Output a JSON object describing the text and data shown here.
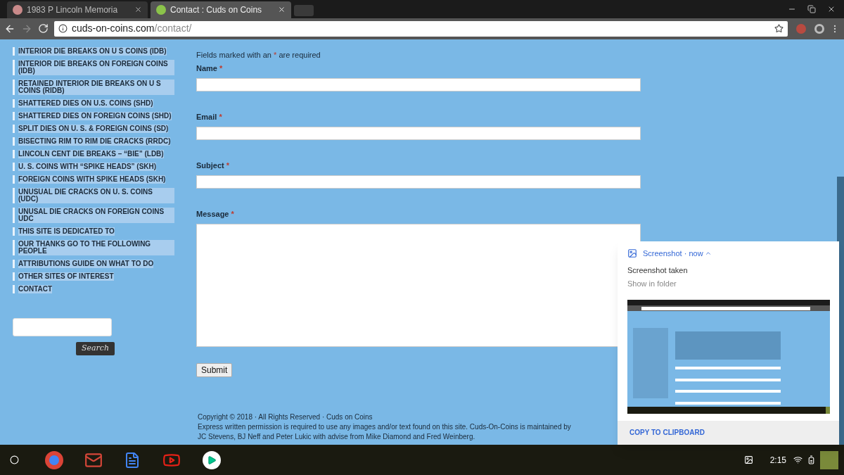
{
  "browser": {
    "tabs": [
      {
        "title": "1983 P Lincoln Memoria",
        "selected": false
      },
      {
        "title": "Contact : Cuds on Coins",
        "selected": true
      }
    ],
    "url_host": "cuds-on-coins.com",
    "url_path": "/contact/"
  },
  "sidebar": {
    "items": [
      {
        "label": "INTERIOR DIE BREAKS ON U S COINS (IDB)"
      },
      {
        "label": "INTERIOR DIE BREAKS ON FOREIGN COINS (IDB)"
      },
      {
        "label": "RETAINED INTERIOR DIE BREAKS ON U S COINS (RIDB)"
      },
      {
        "label": "SHATTERED DIES ON U.S. COINS (SHD)"
      },
      {
        "label": "SHATTERED DIES ON FOREIGN COINS (SHD)"
      },
      {
        "label": "SPLIT DIES ON U. S. & FOREIGN COINS (SD)"
      },
      {
        "label": "BISECTING RIM TO RIM DIE CRACKS (RRDC)"
      },
      {
        "label": "LINCOLN CENT DIE BREAKS – “BIE” (LDB)"
      },
      {
        "label": "U. S. COINS WITH “SPIKE HEADS” (SKH)"
      },
      {
        "label": "FOREIGN COINS WITH SPIKE HEADS (SKH)"
      },
      {
        "label": "UNUSUAL DIE CRACKS ON U. S. COINS (UDC)"
      },
      {
        "label": "UNUSAL DIE CRACKS ON FOREIGN COINS UDC"
      },
      {
        "label": "THIS SITE IS DEDICATED TO"
      },
      {
        "label": "OUR THANKS GO TO THE FOLLOWING PEOPLE"
      },
      {
        "label": "ATTRIBUTIONS GUIDE ON WHAT TO DO"
      },
      {
        "label": "OTHER SITES OF INTEREST"
      },
      {
        "label": "CONTACT"
      }
    ],
    "search_button": "Search"
  },
  "form": {
    "note_before": "Fields marked with an",
    "required_mark": "*",
    "note_after": "are required",
    "fields": [
      {
        "label": "Name",
        "kind": "input"
      },
      {
        "label": "Email",
        "kind": "input"
      },
      {
        "label": "Subject",
        "kind": "input"
      },
      {
        "label": "Message",
        "kind": "textarea"
      }
    ],
    "submit": "Submit"
  },
  "footer": {
    "copyright": "Copyright © 2018 · All Rights Reserved · Cuds on Coins",
    "text": "Express written permission is required to use any images and/or text found on this site. Cuds-On-Coins is maintained by JC Stevens, BJ Neff and Peter Lukic with advise from Mike Diamond and Fred Weinberg."
  },
  "notification": {
    "app": "Screenshot",
    "separator": "·",
    "time": "now",
    "title": "Screenshot taken",
    "subtitle": "Show in folder",
    "action": "COPY TO CLIPBOARD"
  },
  "taskbar": {
    "time": "2:15"
  }
}
